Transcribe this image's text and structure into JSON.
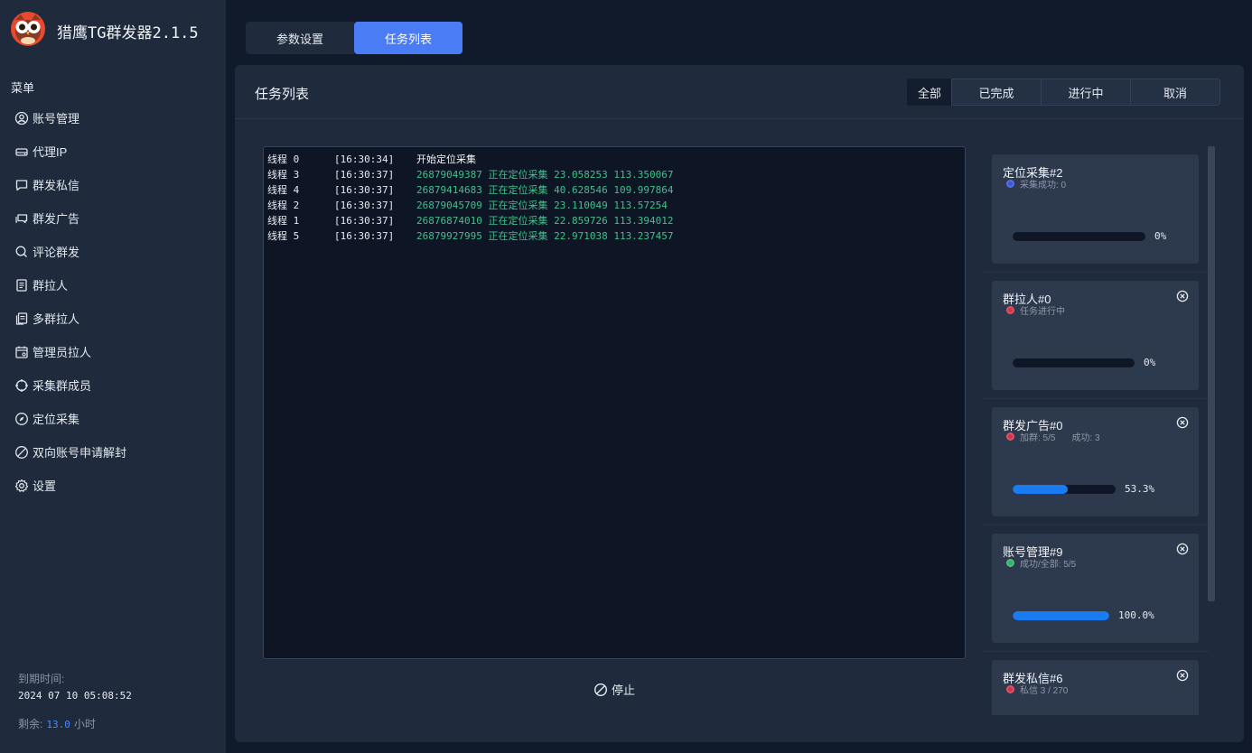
{
  "app": {
    "title": "猎鹰TG群发器2.1.5"
  },
  "sidebar": {
    "menu_heading": "菜单",
    "items": [
      {
        "label": "账号管理",
        "icon": "user-circle-icon"
      },
      {
        "label": "代理IP",
        "icon": "server-icon"
      },
      {
        "label": "群发私信",
        "icon": "chat-bubble-icon"
      },
      {
        "label": "群发广告",
        "icon": "chat-bubbles-icon"
      },
      {
        "label": "评论群发",
        "icon": "comment-search-icon"
      },
      {
        "label": "群拉人",
        "icon": "document-icon"
      },
      {
        "label": "多群拉人",
        "icon": "documents-icon"
      },
      {
        "label": "管理员拉人",
        "icon": "calendar-user-icon"
      },
      {
        "label": "采集群成员",
        "icon": "crosshair-icon"
      },
      {
        "label": "定位采集",
        "icon": "compass-icon"
      },
      {
        "label": "双向账号申请解封",
        "icon": "ban-icon"
      },
      {
        "label": "设置",
        "icon": "gear-icon"
      }
    ],
    "expiry_label": "到期时间:",
    "expiry_value": "2024 07 10 05:08:52",
    "remaining_label": "剩余:",
    "remaining_value": "13.0",
    "remaining_unit": "小时"
  },
  "tabs": [
    {
      "label": "参数设置",
      "active": false
    },
    {
      "label": "任务列表",
      "active": true
    }
  ],
  "panel": {
    "title": "任务列表",
    "filters": [
      "全部",
      "已完成",
      "进行中",
      "取消"
    ],
    "active_filter": "全部"
  },
  "log": [
    {
      "thread": "线程 0",
      "time": "[16:30:34]",
      "msg": "开始定位采集",
      "white": true
    },
    {
      "thread": "线程 3",
      "time": "[16:30:37]",
      "msg": "26879049387 正在定位采集 23.058253 113.350067",
      "white": false
    },
    {
      "thread": "线程 4",
      "time": "[16:30:37]",
      "msg": "26879414683 正在定位采集 40.628546 109.997864",
      "white": false
    },
    {
      "thread": "线程 2",
      "time": "[16:30:37]",
      "msg": "26879045709 正在定位采集 23.110049 113.57254",
      "white": false
    },
    {
      "thread": "线程 1",
      "time": "[16:30:37]",
      "msg": "26876874010 正在定位采集 22.859726 113.394012",
      "white": false
    },
    {
      "thread": "线程 5",
      "time": "[16:30:37]",
      "msg": "26879927995 正在定位采集 22.971038 113.237457",
      "white": false
    }
  ],
  "stop_label": "停止",
  "tasks": [
    {
      "title": "定位采集#2",
      "status": "采集成功: 0",
      "extra": "",
      "dot_color": "#3a55e0",
      "progress": 0,
      "pct_label": "0%",
      "closable": false
    },
    {
      "title": "群拉人#0",
      "status": "任务进行中",
      "extra": "",
      "dot_color": "#d4344a",
      "progress": 0,
      "pct_label": "0%",
      "closable": true
    },
    {
      "title": "群发广告#0",
      "status": "加群: 5/5",
      "extra": "成功: 3",
      "dot_color": "#d4344a",
      "progress": 53.3,
      "pct_label": "53.3%",
      "closable": true
    },
    {
      "title": "账号管理#9",
      "status": "成功/全部: 5/5",
      "extra": "",
      "dot_color": "#2fb36a",
      "progress": 100,
      "pct_label": "100.0%",
      "closable": true
    },
    {
      "title": "群发私信#6",
      "status": "私信 3 / 270",
      "extra": "",
      "dot_color": "#d4344a",
      "progress": 1.1,
      "pct_label": "",
      "closable": true
    }
  ],
  "colors": {
    "accent": "#4a7cf6",
    "progress": "#1a7cf2",
    "log_green": "#3fc18a"
  }
}
